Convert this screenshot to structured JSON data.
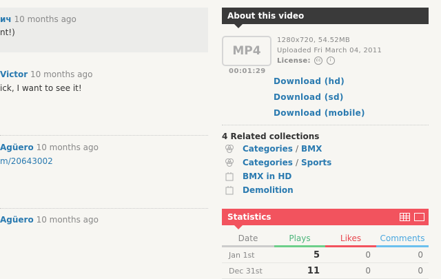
{
  "comments": [
    {
      "author": "ич",
      "time": "10 months ago",
      "text": "nt!)"
    },
    {
      "author": "Victor",
      "time": "10 months ago",
      "text": "ick, I want to see it!"
    },
    {
      "author": "Agüero",
      "time": "10 months ago",
      "link": "m/20643002"
    },
    {
      "author": "Agüero",
      "time": "10 months ago"
    }
  ],
  "about": {
    "title": "About this video",
    "format": "MP4",
    "duration": "00:01:29",
    "resolution_size": "1280x720, 54.52MB",
    "uploaded": "Uploaded Fri March 04, 2011",
    "license_label": "License:",
    "downloads": [
      "Download (hd)",
      "Download (sd)",
      "Download (mobile)"
    ]
  },
  "related": {
    "title": "4 Related collections",
    "items": [
      {
        "icon": "group-icon",
        "parts": [
          "Categories",
          "BMX"
        ]
      },
      {
        "icon": "group-icon",
        "parts": [
          "Categories",
          "Sports"
        ]
      },
      {
        "icon": "channel-icon",
        "parts": [
          "BMX in HD"
        ]
      },
      {
        "icon": "channel-icon",
        "parts": [
          "Demolition"
        ]
      }
    ]
  },
  "statistics": {
    "title": "Statistics",
    "headers": {
      "date": "Date",
      "plays": "Plays",
      "likes": "Likes",
      "comments": "Comments"
    },
    "rows": [
      {
        "date": "Jan 1st",
        "plays": "5",
        "likes": "0",
        "comments": "0"
      },
      {
        "date": "Dec 31st",
        "plays": "11",
        "likes": "0",
        "comments": "0"
      }
    ]
  },
  "colors": {
    "header_dark": "#3a3a3a",
    "stats_accent": "#f2535e",
    "plays": "#4cb57a",
    "likes": "#e8474f",
    "comments": "#4aa7df",
    "link": "#2a7ab0"
  }
}
